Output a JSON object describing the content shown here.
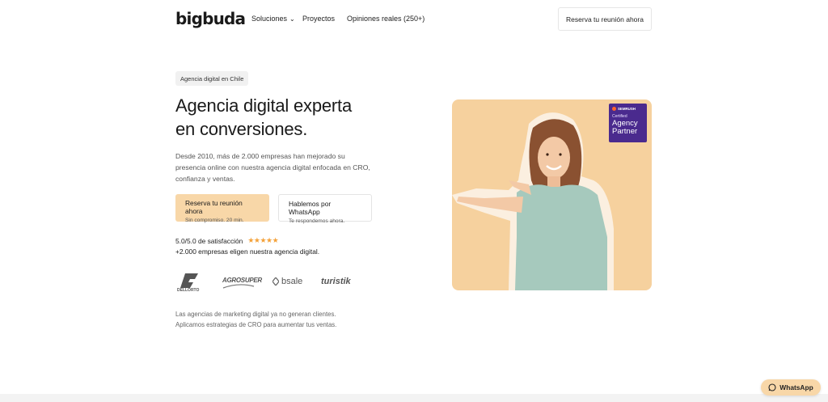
{
  "header": {
    "logo": "bigbuda",
    "nav": [
      {
        "label": "Soluciones",
        "has_dropdown": true
      },
      {
        "label": "Proyectos"
      },
      {
        "label": "Opiniones reales (250+)"
      }
    ],
    "cta": "Reserva tu reunión ahora"
  },
  "hero": {
    "pill": "Agencia digital en Chile",
    "title_line1": "Agencia digital experta",
    "title_line2": "en conversiones.",
    "description": "Desde 2010, más de 2.000 empresas han mejorado su presencia online con nuestra agencia digital enfocada en CRO, confianza y ventas.",
    "primary_button": {
      "label": "Reserva tu reunión ahora",
      "sublabel": "Sin compromiso. 20 min."
    },
    "secondary_button": {
      "label": "Hablemos por WhatsApp",
      "sublabel": "Te respondemos ahora."
    },
    "rating": {
      "text": "5.0/5.0 de satisfacción",
      "stars": 5,
      "stars_glyph": "★★★★★"
    },
    "rating_sub": "+2.000 empresas eligen nuestra agencia digital.",
    "client_logos": [
      {
        "name": "DELLORTO"
      },
      {
        "name": "AGROSUPER"
      },
      {
        "name": "bsale"
      },
      {
        "name": "turistik"
      }
    ],
    "footnote_line1": "Las agencias de marketing digital ya no generan clientes.",
    "footnote_line2": "Aplicamos estrategias de CRO para aumentar tus ventas."
  },
  "badge": {
    "brand": "SEMRUSH",
    "certified": "Certified",
    "line1": "Agency",
    "line2": "Partner"
  },
  "whatsapp_float": "WhatsApp",
  "colors": {
    "accent": "#f8d7a8",
    "star": "#f4a23a",
    "hero_bg": "#f6d19e",
    "badge_bg": "#4a2a8e"
  }
}
